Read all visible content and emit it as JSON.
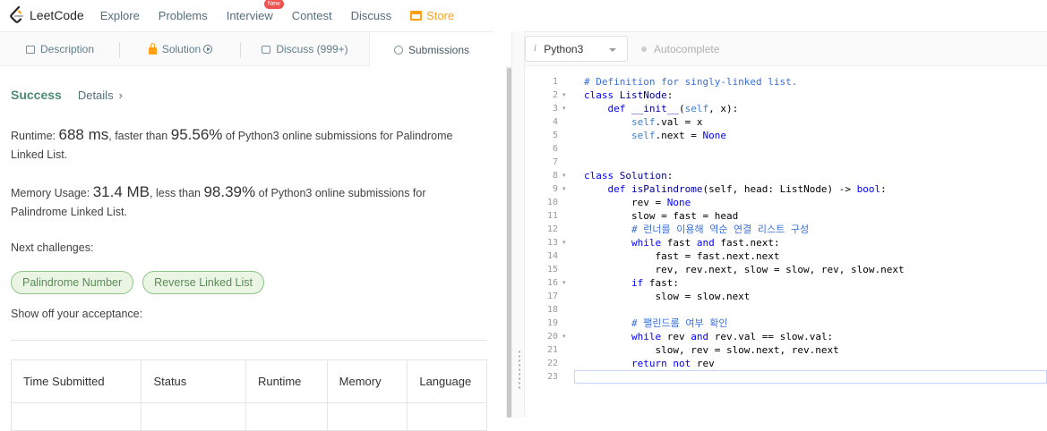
{
  "nav": {
    "logo": "LeetCode",
    "items": [
      "Explore",
      "Problems",
      "Interview",
      "Contest",
      "Discuss"
    ],
    "interview_badge": "New",
    "store": "Store"
  },
  "left_tabs": {
    "description": "Description",
    "solution": "Solution",
    "discuss": "Discuss (999+)",
    "submissions": "Submissions"
  },
  "result": {
    "status": "Success",
    "details": "Details",
    "runtime_label": "Runtime: ",
    "runtime_value": "688 ms",
    "runtime_mid": ", faster than ",
    "runtime_pct": "95.56%",
    "runtime_tail": " of Python3 online submissions for Palindrome Linked List.",
    "memory_label": "Memory Usage: ",
    "memory_value": "31.4 MB",
    "memory_mid": ", less than ",
    "memory_pct": "98.39%",
    "memory_tail": " of Python3 online submissions for Palindrome Linked List.",
    "next_label": "Next challenges:",
    "challenges": [
      "Palindrome Number",
      "Reverse Linked List"
    ],
    "show_off": "Show off your acceptance:"
  },
  "table": {
    "headers": [
      "Time Submitted",
      "Status",
      "Runtime",
      "Memory",
      "Language"
    ]
  },
  "editor": {
    "language": "Python3",
    "autocomplete": "Autocomplete",
    "line_numbers": [
      "1",
      "2",
      "3",
      "4",
      "5",
      "6",
      "7",
      "8",
      "9",
      "10",
      "11",
      "12",
      "13",
      "14",
      "15",
      "16",
      "17",
      "18",
      "19",
      "20",
      "21",
      "22",
      "23"
    ],
    "fold_lines": [
      2,
      3,
      8,
      9,
      13,
      16,
      20
    ]
  }
}
